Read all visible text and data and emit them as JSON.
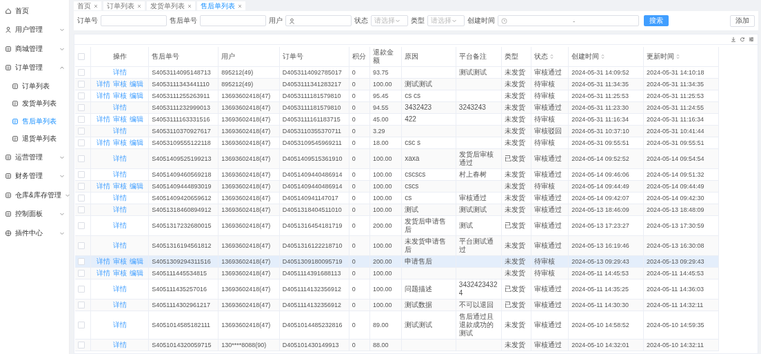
{
  "sidebar": {
    "items": [
      {
        "label": "首页",
        "kind": "link"
      },
      {
        "label": "用户管理",
        "kind": "group",
        "expanded": false
      },
      {
        "label": "商城管理",
        "kind": "group",
        "expanded": false
      },
      {
        "label": "订单管理",
        "kind": "group",
        "expanded": true,
        "children": [
          {
            "label": "订单列表",
            "selected": false
          },
          {
            "label": "发货单列表",
            "selected": false
          },
          {
            "label": "售后单列表",
            "selected": true
          },
          {
            "label": "退货单列表",
            "selected": false
          }
        ]
      },
      {
        "label": "运营管理",
        "kind": "group",
        "expanded": false
      },
      {
        "label": "财务管理",
        "kind": "group",
        "expanded": false
      },
      {
        "label": "仓库&库存管理",
        "kind": "group",
        "expanded": false
      },
      {
        "label": "控制面板",
        "kind": "group",
        "expanded": false
      },
      {
        "label": "插件中心",
        "kind": "group",
        "expanded": false
      }
    ]
  },
  "tabs": [
    {
      "label": "首页",
      "selected": false
    },
    {
      "label": "订单列表",
      "selected": false
    },
    {
      "label": "发货单列表",
      "selected": false
    },
    {
      "label": "售后单列表",
      "selected": true
    }
  ],
  "filters": [
    {
      "label": "订单号",
      "kind": "text"
    },
    {
      "label": "售后单号",
      "kind": "text"
    },
    {
      "label": "用户",
      "kind": "user"
    },
    {
      "label": "状态",
      "kind": "select",
      "placeholder": "请选择"
    },
    {
      "label": "类型",
      "kind": "select",
      "placeholder": "请选择"
    },
    {
      "label": "创建时间",
      "kind": "daterange",
      "separator": "-"
    }
  ],
  "search_button": "搜索",
  "add_button": "添加",
  "table": {
    "select_all_checked": false,
    "columns": [
      {
        "label": "操作",
        "sortable": false
      },
      {
        "label": "售后单号",
        "sortable": false
      },
      {
        "label": "用户",
        "sortable": false
      },
      {
        "label": "订单号",
        "sortable": false
      },
      {
        "label": "积分",
        "sortable": false
      },
      {
        "label": "退款金额",
        "sortable": false
      },
      {
        "label": "原因",
        "sortable": false
      },
      {
        "label": "平台备注",
        "sortable": false
      },
      {
        "label": "类型",
        "sortable": false
      },
      {
        "label": "状态",
        "sortable": true
      },
      {
        "label": "创建时间",
        "sortable": true
      },
      {
        "label": "更新时间",
        "sortable": true
      }
    ],
    "rows": [
      {
        "checked": false,
        "highlighted": false,
        "actions": [
          "详情"
        ],
        "aftersale_no": "S4053114095148713",
        "user": "895212(49)",
        "order_no": "D4053114092785017",
        "points": "0",
        "refund": "93.75",
        "remark": "测试测试",
        "type": "未发货",
        "status": "审核通过",
        "created": "2024-05-31 14:09:52",
        "updated": "2024-05-31 14:10:18"
      },
      {
        "checked": false,
        "highlighted": false,
        "actions": [
          "详情",
          "审核",
          "编辑"
        ],
        "aftersale_no": "S4053111343441110",
        "user": "895212(49)",
        "order_no": "D4053111341283217",
        "points": "0",
        "refund": "100.00",
        "reason": "测试测试",
        "type": "未发货",
        "status": "待审核",
        "created": "2024-05-31 11:34:35",
        "updated": "2024-05-31 11:34:35"
      },
      {
        "checked": false,
        "highlighted": false,
        "actions": [
          "详情",
          "审核",
          "编辑"
        ],
        "aftersale_no": "S4053111255263911",
        "user": "13693602418(47)",
        "order_no": "D4053111181579810",
        "points": "0",
        "refund": "95.45",
        "reason": "cs cs",
        "type": "未发货",
        "status": "待审核",
        "created": "2024-05-31 11:25:53",
        "updated": "2024-05-31 11:25:53"
      },
      {
        "checked": false,
        "highlighted": false,
        "actions": [
          "详情"
        ],
        "aftersale_no": "S4053111232999013",
        "user": "13693602418(47)",
        "order_no": "D4053111181579810",
        "points": "0",
        "refund": "94.55",
        "reason": "3432423",
        "remark": "3243243",
        "type": "未发货",
        "status": "审核通过",
        "created": "2024-05-31 11:23:30",
        "updated": "2024-05-31 11:24:55"
      },
      {
        "checked": false,
        "highlighted": false,
        "actions": [
          "详情",
          "审核",
          "编辑"
        ],
        "aftersale_no": "S4053111163331516",
        "user": "13693602418(47)",
        "order_no": "D4053111161183715",
        "points": "0",
        "refund": "45.00",
        "reason": "422",
        "type": "未发货",
        "status": "待审核",
        "created": "2024-05-31 11:16:34",
        "updated": "2024-05-31 11:16:34"
      },
      {
        "checked": false,
        "highlighted": false,
        "actions": [
          "详情"
        ],
        "aftersale_no": "S4053110370927617",
        "user": "13693602418(47)",
        "order_no": "D4053110355370711",
        "points": "0",
        "refund": "3.29",
        "type": "未发货",
        "status": "审核驳回",
        "created": "2024-05-31 10:37:10",
        "updated": "2024-05-31 10:41:44"
      },
      {
        "checked": false,
        "highlighted": false,
        "actions": [
          "详情",
          "审核",
          "编辑"
        ],
        "aftersale_no": "S4053109555122118",
        "user": "13693602418(47)",
        "order_no": "D4053109545969211",
        "points": "0",
        "refund": "18.00",
        "reason": "csc s",
        "type": "未发货",
        "status": "待审核",
        "created": "2024-05-31 09:55:51",
        "updated": "2024-05-31 09:55:51"
      },
      {
        "checked": false,
        "highlighted": false,
        "actions": [
          "详情"
        ],
        "aftersale_no": "S4051409525199213",
        "user": "13693602418(47)",
        "order_no": "D4051409515361910",
        "points": "0",
        "refund": "100.00",
        "reason": "xaxa",
        "remark": "发货后审核通过",
        "type": "已发货",
        "status": "审核通过",
        "created": "2024-05-14 09:52:52",
        "updated": "2024-05-14 09:54:54"
      },
      {
        "checked": false,
        "highlighted": false,
        "actions": [
          "详情"
        ],
        "aftersale_no": "S4051409460569218",
        "user": "13693602418(47)",
        "order_no": "D4051409440486914",
        "points": "0",
        "refund": "100.00",
        "reason": "cscscs",
        "remark": "村上春树",
        "type": "未发货",
        "status": "审核通过",
        "created": "2024-05-14 09:46:06",
        "updated": "2024-05-14 09:51:32"
      },
      {
        "checked": false,
        "highlighted": false,
        "actions": [
          "详情",
          "审核",
          "编辑"
        ],
        "aftersale_no": "S4051409444893019",
        "user": "13693602418(47)",
        "order_no": "D4051409440486914",
        "points": "0",
        "refund": "100.00",
        "reason": "cscs",
        "type": "未发货",
        "status": "待审核",
        "created": "2024-05-14 09:44:49",
        "updated": "2024-05-14 09:44:49"
      },
      {
        "checked": false,
        "highlighted": false,
        "actions": [
          "详情"
        ],
        "aftersale_no": "S4051409420659612",
        "user": "13693602418(47)",
        "order_no": "D405140941147017",
        "points": "0",
        "refund": "100.00",
        "reason": "cs",
        "remark": "审核通过",
        "type": "未发货",
        "status": "审核通过",
        "created": "2024-05-14 09:42:07",
        "updated": "2024-05-14 09:42:30"
      },
      {
        "checked": false,
        "highlighted": false,
        "actions": [
          "详情"
        ],
        "aftersale_no": "S4051318460894912",
        "user": "13693602418(47)",
        "order_no": "D4051318404511010",
        "points": "0",
        "refund": "100.00",
        "reason": "测试",
        "remark": "测试测试",
        "type": "未发货",
        "status": "审核通过",
        "created": "2024-05-13 18:46:09",
        "updated": "2024-05-13 18:48:09"
      },
      {
        "checked": false,
        "highlighted": false,
        "actions": [
          "详情"
        ],
        "aftersale_no": "S4051317232680015",
        "user": "13693602418(47)",
        "order_no": "D4051316454181719",
        "points": "0",
        "refund": "200.00",
        "reason": "发货后申请售后",
        "remark": "测试",
        "type": "已发货",
        "status": "审核通过",
        "created": "2024-05-13 17:23:27",
        "updated": "2024-05-13 17:30:59"
      },
      {
        "checked": false,
        "highlighted": false,
        "actions": [
          "详情"
        ],
        "aftersale_no": "S4051316194561812",
        "user": "13693602418(47)",
        "order_no": "D4051316122218710",
        "points": "0",
        "refund": "100.00",
        "reason": "未发货申请售后",
        "remark": "平台测试通过",
        "type": "未发货",
        "status": "审核通过",
        "created": "2024-05-13 16:19:46",
        "updated": "2024-05-13 16:30:08"
      },
      {
        "checked": false,
        "highlighted": true,
        "actions": [
          "详情",
          "审核",
          "编辑"
        ],
        "aftersale_no": "S4051309294311516",
        "user": "13693602418(47)",
        "order_no": "D4051309180095719",
        "points": "0",
        "refund": "200.00",
        "reason": "申请售后",
        "type": "未发货",
        "status": "待审核",
        "created": "2024-05-13 09:29:43",
        "updated": "2024-05-13 09:29:43"
      },
      {
        "checked": false,
        "highlighted": false,
        "actions": [
          "详情",
          "审核",
          "编辑"
        ],
        "aftersale_no": "S405111445534815",
        "user": "13693602418(47)",
        "order_no": "D4051114391688113",
        "points": "0",
        "refund": "100.00",
        "type": "未发货",
        "status": "待审核",
        "created": "2024-05-11 14:45:53",
        "updated": "2024-05-11 14:45:53"
      },
      {
        "checked": false,
        "highlighted": false,
        "actions": [
          "详情"
        ],
        "aftersale_no": "S405111435257016",
        "user": "13693602418(47)",
        "order_no": "D4051114132356912",
        "points": "0",
        "refund": "100.00",
        "reason": "问题描述",
        "remark": "34324234324",
        "type": "已发货",
        "status": "审核通过",
        "created": "2024-05-11 14:35:25",
        "updated": "2024-05-11 14:36:03"
      },
      {
        "checked": false,
        "highlighted": false,
        "actions": [
          "详情"
        ],
        "aftersale_no": "S4051114302961217",
        "user": "13693602418(47)",
        "order_no": "D4051114132356912",
        "points": "0",
        "refund": "100.00",
        "reason": "测试数据",
        "remark": "不可以退回",
        "type": "已发货",
        "status": "审核通过",
        "created": "2024-05-11 14:30:30",
        "updated": "2024-05-11 14:32:11"
      },
      {
        "checked": false,
        "highlighted": false,
        "actions": [
          "详情"
        ],
        "aftersale_no": "S4051014585182111",
        "user": "13693602418(47)",
        "order_no": "D4051014485232816",
        "points": "0",
        "refund": "89.00",
        "reason": "测试测试",
        "remark": "售后通过且退款成功的测试",
        "type": "未发货",
        "status": "审核通过",
        "created": "2024-05-10 14:58:52",
        "updated": "2024-05-10 14:59:35"
      },
      {
        "checked": false,
        "highlighted": false,
        "actions": [
          "详情"
        ],
        "aftersale_no": "S4051014320059715",
        "user": "130****8088(90)",
        "order_no": "D405101430149913",
        "points": "0",
        "refund": "88.00",
        "type": "未发货",
        "status": "审核通过",
        "created": "2024-05-10 14:32:01",
        "updated": "2024-05-10 14:32:11"
      }
    ]
  }
}
